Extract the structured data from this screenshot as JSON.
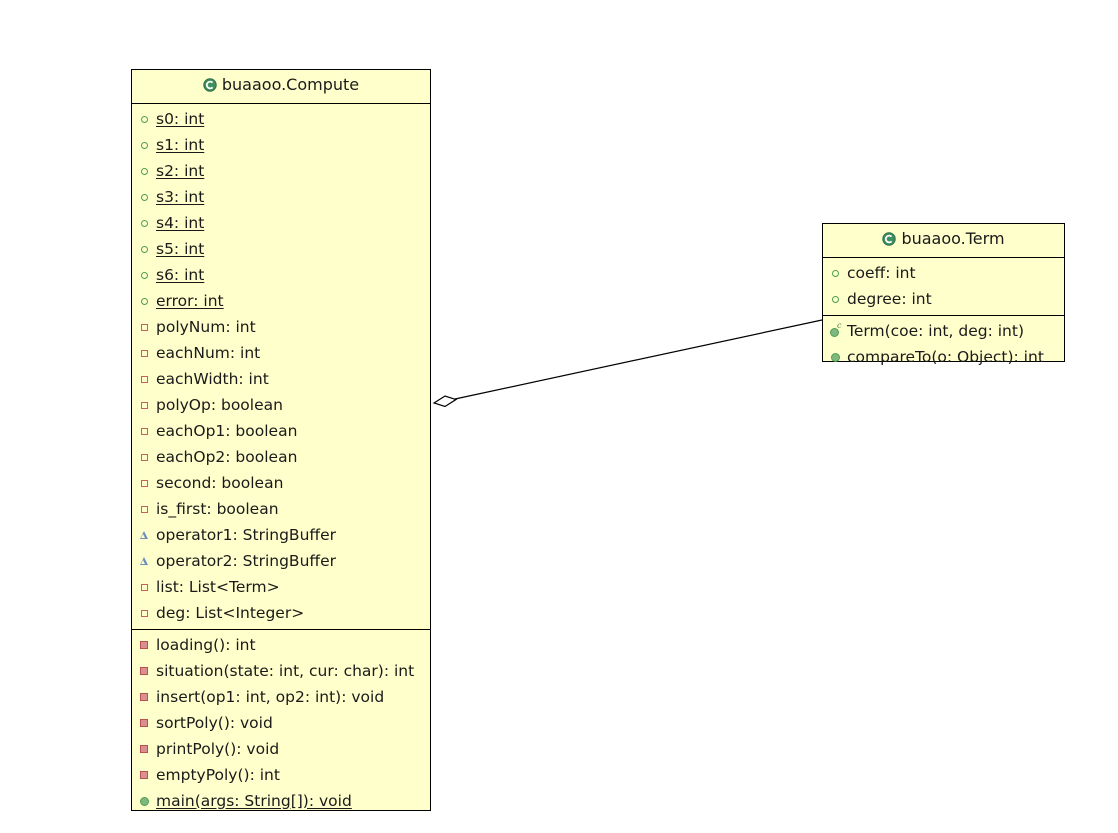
{
  "diagram": {
    "kind": "uml-class-diagram",
    "background": "#ffffff",
    "class_fill": "#ffffcc",
    "border_color": "#000000",
    "icons": {
      "class": "class-icon-green-c",
      "public_field": "public-field-icon",
      "private_field": "private-field-icon",
      "protected_field": "protected-field-icon",
      "private_method": "private-method-icon",
      "public_method": "public-method-icon",
      "constructor": "constructor-icon"
    }
  },
  "classes": [
    {
      "id": "compute",
      "title": "buaaoo.Compute",
      "sections": [
        {
          "kind": "fields",
          "members": [
            {
              "label": "s0: int",
              "icon": "public_field",
              "static": true
            },
            {
              "label": "s1: int",
              "icon": "public_field",
              "static": true
            },
            {
              "label": "s2: int",
              "icon": "public_field",
              "static": true
            },
            {
              "label": "s3: int",
              "icon": "public_field",
              "static": true
            },
            {
              "label": "s4: int",
              "icon": "public_field",
              "static": true
            },
            {
              "label": "s5: int",
              "icon": "public_field",
              "static": true
            },
            {
              "label": "s6: int",
              "icon": "public_field",
              "static": true
            },
            {
              "label": "error: int",
              "icon": "public_field",
              "static": true
            },
            {
              "label": "polyNum: int",
              "icon": "private_field",
              "static": false
            },
            {
              "label": "eachNum: int",
              "icon": "private_field",
              "static": false
            },
            {
              "label": "eachWidth: int",
              "icon": "private_field",
              "static": false
            },
            {
              "label": "polyOp: boolean",
              "icon": "private_field",
              "static": false
            },
            {
              "label": "eachOp1: boolean",
              "icon": "private_field",
              "static": false
            },
            {
              "label": "eachOp2: boolean",
              "icon": "private_field",
              "static": false
            },
            {
              "label": "second: boolean",
              "icon": "private_field",
              "static": false
            },
            {
              "label": "is_first: boolean",
              "icon": "private_field",
              "static": false
            },
            {
              "label": "operator1: StringBuffer",
              "icon": "protected_field",
              "static": false
            },
            {
              "label": "operator2: StringBuffer",
              "icon": "protected_field",
              "static": false
            },
            {
              "label": "list: List<Term>",
              "icon": "private_field",
              "static": false
            },
            {
              "label": "deg: List<Integer>",
              "icon": "private_field",
              "static": false
            }
          ]
        },
        {
          "kind": "methods",
          "members": [
            {
              "label": "loading(): int",
              "icon": "private_method",
              "static": false
            },
            {
              "label": "situation(state: int, cur: char): int",
              "icon": "private_method",
              "static": false
            },
            {
              "label": "insert(op1: int, op2: int): void",
              "icon": "private_method",
              "static": false
            },
            {
              "label": "sortPoly(): void",
              "icon": "private_method",
              "static": false
            },
            {
              "label": "printPoly(): void",
              "icon": "private_method",
              "static": false
            },
            {
              "label": "emptyPoly(): int",
              "icon": "private_method",
              "static": false
            },
            {
              "label": "main(args: String[]): void",
              "icon": "public_method",
              "static": true
            }
          ]
        }
      ]
    },
    {
      "id": "term",
      "title": "buaaoo.Term",
      "sections": [
        {
          "kind": "fields",
          "members": [
            {
              "label": "coeff: int",
              "icon": "public_field",
              "static": false
            },
            {
              "label": "degree: int",
              "icon": "public_field",
              "static": false
            }
          ]
        },
        {
          "kind": "methods",
          "members": [
            {
              "label": "Term(coe: int, deg: int)",
              "icon": "constructor",
              "static": false
            },
            {
              "label": "compareTo(o: Object): int",
              "icon": "public_method",
              "static": false
            }
          ]
        }
      ]
    }
  ],
  "relationships": [
    {
      "type": "aggregation",
      "from": "term",
      "to": "compute",
      "diamond_end": "compute"
    }
  ]
}
